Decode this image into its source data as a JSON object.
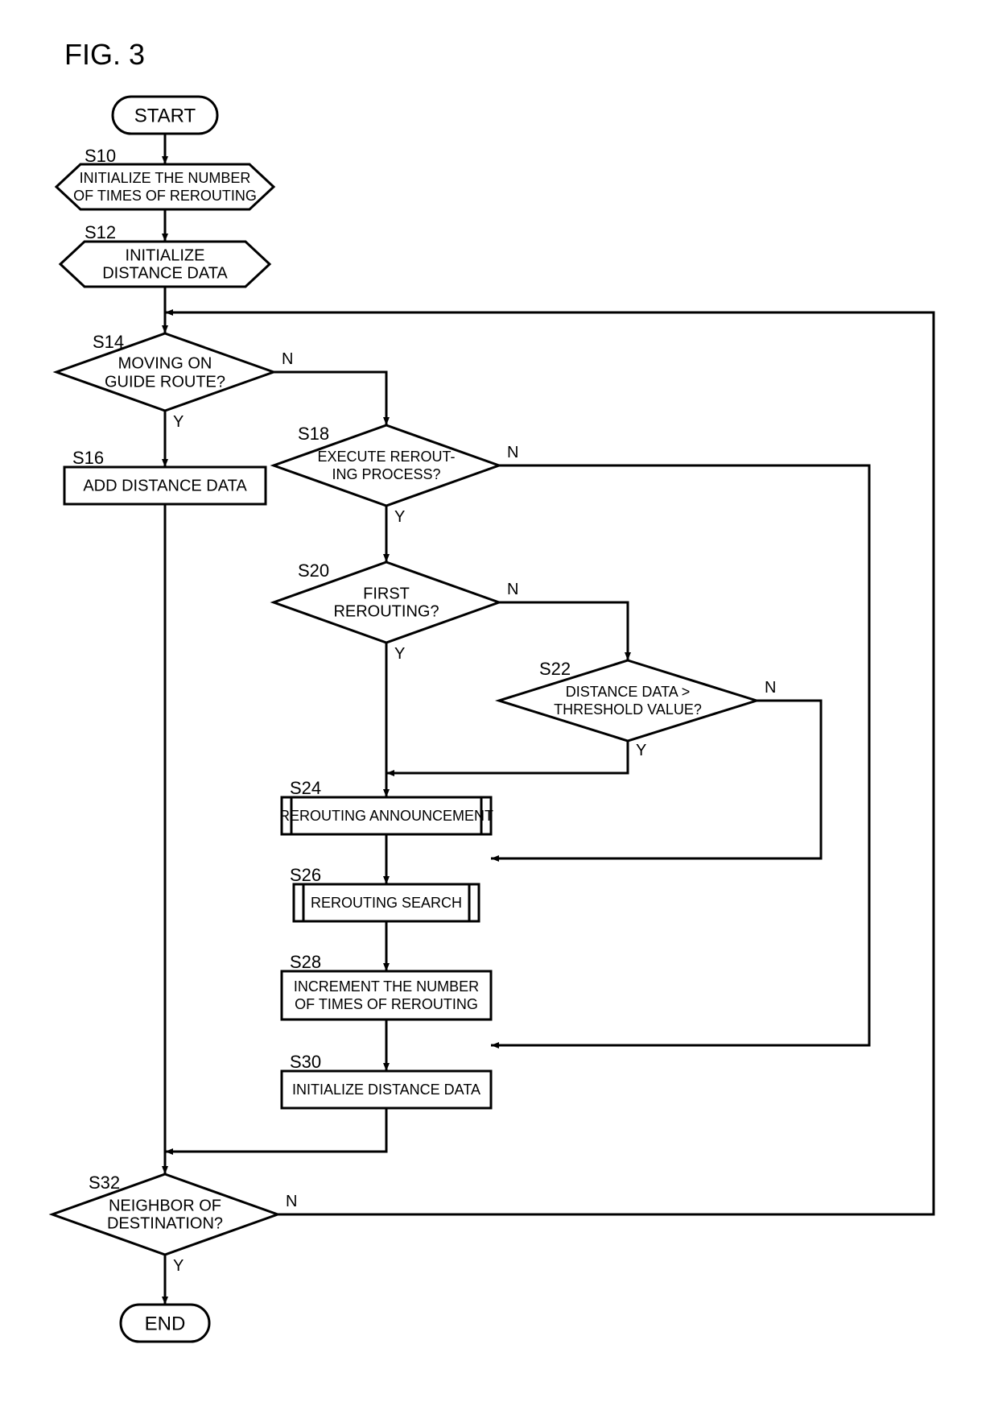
{
  "figure_title": "FIG. 3",
  "nodes": {
    "start": {
      "text": "START"
    },
    "end": {
      "text": "END"
    },
    "s10": {
      "label": "S10",
      "line1": "INITIALIZE THE NUMBER",
      "line2": "OF TIMES OF REROUTING"
    },
    "s12": {
      "label": "S12",
      "line1": "INITIALIZE",
      "line2": "DISTANCE DATA"
    },
    "s14": {
      "label": "S14",
      "line1": "MOVING ON",
      "line2": "GUIDE ROUTE?"
    },
    "s16": {
      "label": "S16",
      "line1": "ADD DISTANCE  DATA"
    },
    "s18": {
      "label": "S18",
      "line1": "EXECUTE REROUT-",
      "line2": "ING PROCESS?"
    },
    "s20": {
      "label": "S20",
      "line1": "FIRST",
      "line2": "REROUTING?"
    },
    "s22": {
      "label": "S22",
      "line1": "DISTANCE DATA >",
      "line2": "THRESHOLD VALUE?"
    },
    "s24": {
      "label": "S24",
      "line1": "REROUTING ANNOUNCEMENT"
    },
    "s26": {
      "label": "S26",
      "line1": "REROUTING  SEARCH"
    },
    "s28": {
      "label": "S28",
      "line1": "INCREMENT THE NUMBER",
      "line2": "OF TIMES OF REROUTING"
    },
    "s30": {
      "label": "S30",
      "line1": "INITIALIZE DISTANCE DATA"
    },
    "s32": {
      "label": "S32",
      "line1": "NEIGHBOR OF",
      "line2": "DESTINATION?"
    }
  },
  "edges": {
    "yes": "Y",
    "no": "N"
  }
}
